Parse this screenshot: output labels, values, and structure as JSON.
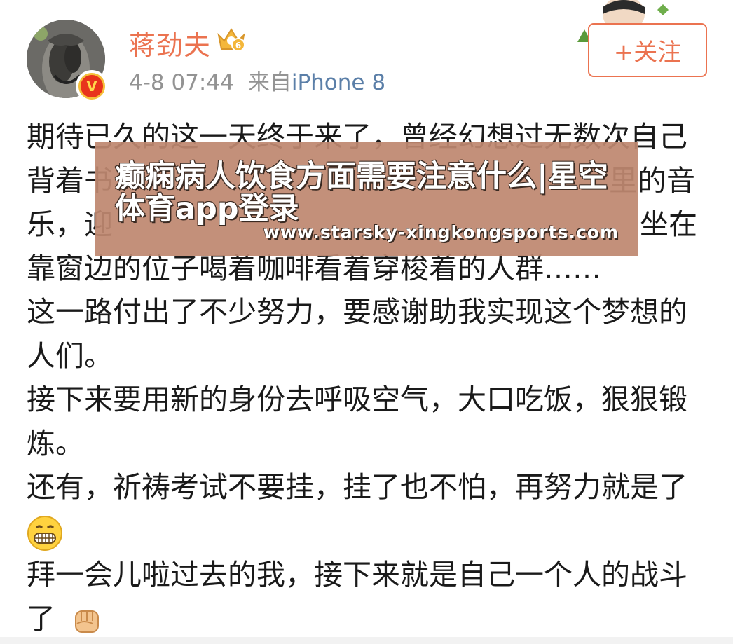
{
  "post": {
    "username": "蒋劲夫",
    "level_badge": "6",
    "verified_mark": "V",
    "time": "4-8 07:44",
    "source_prefix": "来自",
    "source_name": "iPhone 8",
    "follow_label": "+关注",
    "lines": [
      "期待已久的这一天终于来了，曾经幻想过无数次自己",
      "背着书",
      "乐，迎",
      "靠窗边的位子喝着咖啡看着穿梭着的人群……",
      "这一路付出了不少努力，要感谢助我实现这个梦想的",
      "人们。",
      "接下来要用新的身份去呼吸空气，大口吃饭，狠狠锻",
      "炼。",
      "还有，祈祷考试不要挂，挂了也不怕，再努力就是了",
      "",
      "拜一会儿啦过去的我，接下来就是自己一个人的战斗",
      "了"
    ],
    "line2_tail": "里的音",
    "line3_tail": "坐在"
  },
  "overlay": {
    "title": "癫痫病人饮食方面需要注意什么|星空体育app登录",
    "url": "www.starsky-xingkongsports.com"
  },
  "icons": {
    "avatar": "tattooed-arm-avatar",
    "verified": "verified-badge-icon",
    "crown": "crown-level-icon",
    "grin": "grin-emoji-icon",
    "fist": "fist-emoji-icon"
  },
  "colors": {
    "accent": "#eb7350",
    "meta": "#939393",
    "link": "#5b7fa8",
    "overlay": "#be8870"
  }
}
